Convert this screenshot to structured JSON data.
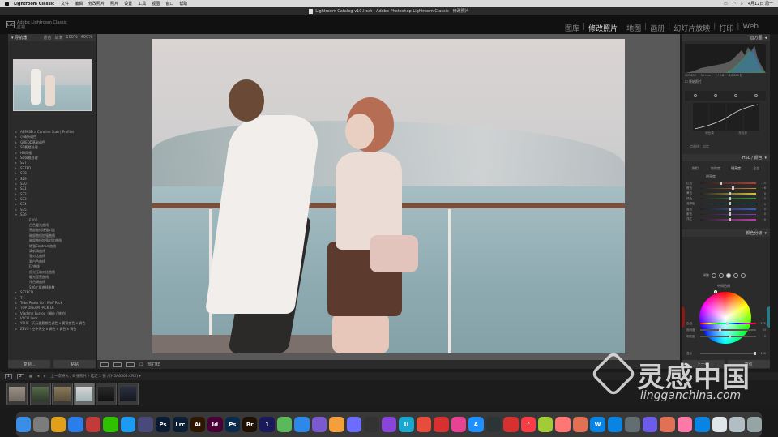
{
  "menubar": {
    "app_name": "Lightroom Classic",
    "menus": [
      "文件",
      "编辑",
      "修改照片",
      "照片",
      "设置",
      "工具",
      "视图",
      "窗口",
      "帮助"
    ],
    "status_right": "4月12日 周一"
  },
  "window": {
    "title": "Lightroom Catalog-v10.lrcat - Adobe Photoshop Lightroom Classic - 修改照片"
  },
  "identity": {
    "logo": "LrC",
    "line1": "Adobe Lightroom Classic",
    "line2": "星视"
  },
  "modules": [
    "图库",
    "修改照片",
    "地图",
    "画册",
    "幻灯片放映",
    "打印",
    "Web"
  ],
  "modules_active": "修改照片",
  "left_panel": {
    "navigator_title": "导航器",
    "zoom_options": [
      "适合",
      "填满",
      "100%",
      "400%"
    ],
    "presets": [
      {
        "label": "ABPASD a Caroline Stan | Profiles",
        "open": false,
        "child": false
      },
      {
        "label": "小清新调色",
        "open": false,
        "child": false
      },
      {
        "label": "GDEDD基础调色",
        "open": false,
        "child": false
      },
      {
        "label": "SD影楼处理",
        "open": false,
        "child": false
      },
      {
        "label": "HD风格",
        "open": false,
        "child": false
      },
      {
        "label": "SD风格处理",
        "open": false,
        "child": false
      },
      {
        "label": "S27",
        "open": false,
        "child": false
      },
      {
        "label": "S27ED",
        "open": false,
        "child": false
      },
      {
        "label": "S28",
        "open": false,
        "child": false
      },
      {
        "label": "S29",
        "open": false,
        "child": false
      },
      {
        "label": "S30",
        "open": false,
        "child": false
      },
      {
        "label": "S31",
        "open": false,
        "child": false
      },
      {
        "label": "S32",
        "open": false,
        "child": false
      },
      {
        "label": "S33",
        "open": false,
        "child": false
      },
      {
        "label": "S34",
        "open": false,
        "child": false
      },
      {
        "label": "S35",
        "open": false,
        "child": false
      },
      {
        "label": "S36",
        "open": true,
        "child": false
      },
      {
        "label": "EX06",
        "open": false,
        "child": true
      },
      {
        "label": "白色暖光曲线",
        "open": false,
        "child": true
      },
      {
        "label": "亮部曲线增强对比",
        "open": false,
        "child": true
      },
      {
        "label": "暗部曲线加强曲线",
        "open": false,
        "child": true
      },
      {
        "label": "暗部曲线加强对比曲线",
        "open": false,
        "child": true
      },
      {
        "label": "增强Contrast曲线",
        "open": false,
        "child": true
      },
      {
        "label": "清新调曲线",
        "open": false,
        "child": true
      },
      {
        "label": "强对比曲线",
        "open": false,
        "child": true
      },
      {
        "label": "乳白色曲线",
        "open": false,
        "child": true
      },
      {
        "label": "F2曲线",
        "open": false,
        "child": true
      },
      {
        "label": "低光压暗对比曲线",
        "open": false,
        "child": true
      },
      {
        "label": "暖光提亮曲线",
        "open": false,
        "child": true
      },
      {
        "label": "冷色调曲线",
        "open": false,
        "child": true
      },
      {
        "label": "S36扩展曲线参数",
        "open": false,
        "child": true
      },
      {
        "label": "S37ECD",
        "open": false,
        "child": false
      },
      {
        "label": "T",
        "open": false,
        "child": false
      },
      {
        "label": "Tribe Photo Co - Wolf Pack",
        "open": false,
        "child": false
      },
      {
        "label": "TOP DREAM PACK LR",
        "open": false,
        "child": false
      },
      {
        "label": "Vladimir Lustov（婚纱 / 旅拍）",
        "open": false,
        "child": false
      },
      {
        "label": "VSCO Lens",
        "open": false,
        "child": false
      },
      {
        "label": "YSHE - 天际摄影颜色调色 x 黄铜夜色 x 调色",
        "open": false,
        "child": false
      },
      {
        "label": "ZEVS - 空中天空 x 调色 x 调色 x 调色",
        "open": false,
        "child": false
      }
    ],
    "copy_label": "复制...",
    "paste_label": "粘贴"
  },
  "toolbar": {
    "softproof_label": "软打样"
  },
  "right_panel": {
    "histogram_title": "直方图",
    "hist_info": [
      "ISO 400",
      "50 mm",
      "f / 1.8",
      "1/1000 秒"
    ],
    "original_photo_label": "原始照片",
    "curve_labels": [
      "暗色调",
      "亮色调"
    ],
    "curve_channel_label": "点曲线：自定",
    "hsl_title": "HSL / 颜色",
    "hsl_tabs": [
      "色相",
      "饱和度",
      "明亮度",
      "全部"
    ],
    "hsl_active": "明亮度",
    "hsl_sub": "明亮度",
    "hsl_sliders": [
      {
        "label": "红色",
        "value": "-15"
      },
      {
        "label": "橙色",
        "value": "+6"
      },
      {
        "label": "黄色",
        "value": "0"
      },
      {
        "label": "绿色",
        "value": "0"
      },
      {
        "label": "浅绿色",
        "value": "0"
      },
      {
        "label": "蓝色",
        "value": "0"
      },
      {
        "label": "紫色",
        "value": "0"
      },
      {
        "label": "洋红",
        "value": "0"
      }
    ],
    "color_grading_title": "颜色分级",
    "cg_mode_label": "调整",
    "cg_sub": "中间色调",
    "cg_sliders": [
      {
        "label": "色相",
        "value": "172"
      },
      {
        "label": "饱和度",
        "value": "33"
      },
      {
        "label": "明亮度",
        "value": "0"
      }
    ],
    "cg_blend_label": "混合",
    "cg_blend_value": "100",
    "prev_label": "上一张",
    "reset_label": "复位"
  },
  "filmstrip": {
    "page1": "1",
    "page2": "2",
    "breadcrumb": "上一次导入 / 6 张照片 / 选定 1 张 / [H5A6302.CR2] ▾"
  },
  "watermark": {
    "title": "灵感中国",
    "url": "lingganchina.com"
  },
  "dock": [
    {
      "name": "finder-icon",
      "label": "",
      "color": "#3a8ee6"
    },
    {
      "name": "launchpad-icon",
      "label": "",
      "color": "#7c7c7c"
    },
    {
      "name": "chrome-icon",
      "label": "",
      "color": "#e0a019"
    },
    {
      "name": "safari-icon",
      "label": "",
      "color": "#2b7de9"
    },
    {
      "name": "app-icon",
      "label": "",
      "color": "#c23b3b"
    },
    {
      "name": "wechat-icon",
      "label": "",
      "color": "#2dc100"
    },
    {
      "name": "qq-icon",
      "label": "",
      "color": "#1d9bf0"
    },
    {
      "name": "app-icon-2",
      "label": "",
      "color": "#4a4a7a"
    },
    {
      "name": "photoshop-icon",
      "label": "Ps",
      "color": "#0a1a33"
    },
    {
      "name": "lightroom-icon",
      "label": "Lrc",
      "color": "#0b1e33"
    },
    {
      "name": "illustrator-icon",
      "label": "Ai",
      "color": "#2e1700"
    },
    {
      "name": "indesign-icon",
      "label": "Id",
      "color": "#470137"
    },
    {
      "name": "photoshop-beta-icon",
      "label": "Ps",
      "color": "#0a2a4a"
    },
    {
      "name": "bridge-icon",
      "label": "Br",
      "color": "#1f1205"
    },
    {
      "name": "app-icon-3",
      "label": "1",
      "color": "#1a1a5a"
    },
    {
      "name": "maps-icon",
      "label": "",
      "color": "#5bb85b"
    },
    {
      "name": "app-icon-4",
      "label": "",
      "color": "#2e88e8"
    },
    {
      "name": "app-icon-5",
      "label": "",
      "color": "#7a5acd"
    },
    {
      "name": "photos-icon",
      "label": "",
      "color": "#f2a03d"
    },
    {
      "name": "app-icon-6",
      "label": "",
      "color": "#6c6cff"
    },
    {
      "name": "final-cut-icon",
      "label": "",
      "color": "#333"
    },
    {
      "name": "app-icon-7",
      "label": "",
      "color": "#8845d8"
    },
    {
      "name": "app-icon-8",
      "label": "U",
      "color": "#19a7ce"
    },
    {
      "name": "app-icon-9",
      "label": "",
      "color": "#e74c3c"
    },
    {
      "name": "app-icon-10",
      "label": "",
      "color": "#d63031"
    },
    {
      "name": "app-icon-11",
      "label": "",
      "color": "#e84393"
    },
    {
      "name": "app-store-icon",
      "label": "A",
      "color": "#1e90ff"
    },
    {
      "name": "app-icon-12",
      "label": "",
      "color": "#2d3436"
    },
    {
      "name": "app-icon-13",
      "label": "",
      "color": "#d63031"
    },
    {
      "name": "music-icon",
      "label": "♪",
      "color": "#fc3c44"
    },
    {
      "name": "app-icon-14",
      "label": "",
      "color": "#a3cb38"
    },
    {
      "name": "app-icon-15",
      "label": "",
      "color": "#ff7675"
    },
    {
      "name": "app-icon-16",
      "label": "",
      "color": "#e17055"
    },
    {
      "name": "app-icon-17",
      "label": "W",
      "color": "#0984e3"
    },
    {
      "name": "app-icon-18",
      "label": "",
      "color": "#0984e3"
    },
    {
      "name": "system-prefs-icon",
      "label": "",
      "color": "#636e72"
    },
    {
      "name": "app-icon-19",
      "label": "",
      "color": "#6c5ce7"
    },
    {
      "name": "app-icon-20",
      "label": "",
      "color": "#e17055"
    },
    {
      "name": "app-icon-21",
      "label": "",
      "color": "#fd79a8"
    },
    {
      "name": "app-icon-22",
      "label": "",
      "color": "#0984e3"
    },
    {
      "name": "app-icon-23",
      "label": "",
      "color": "#dfe6e9"
    },
    {
      "name": "app-icon-24",
      "label": "",
      "color": "#b2bec3"
    },
    {
      "name": "trash-icon",
      "label": "",
      "color": "#95a5a6"
    }
  ]
}
